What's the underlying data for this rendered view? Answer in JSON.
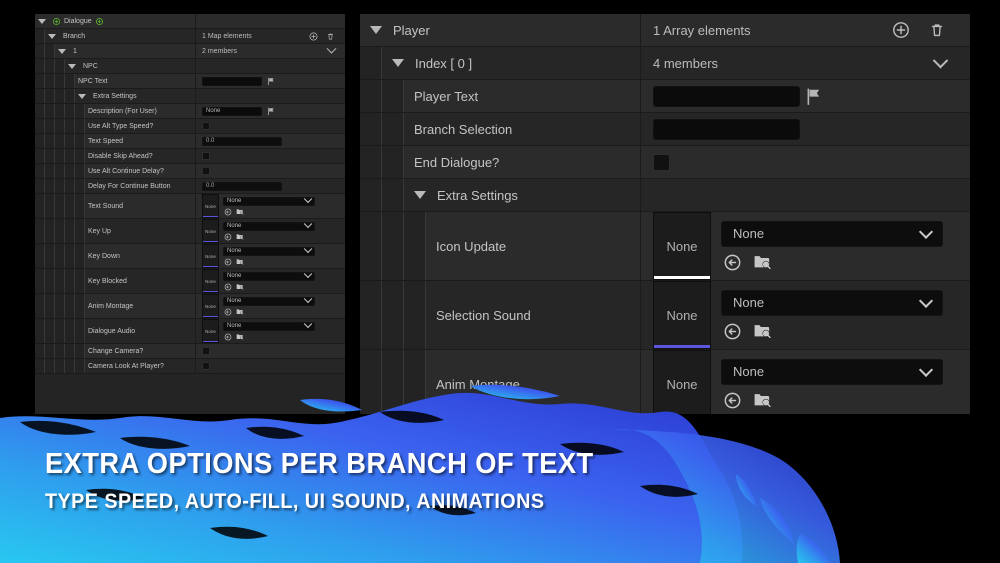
{
  "left_panel": {
    "rows": [
      {
        "kind": "header",
        "depth": 0,
        "label": "Dialogue",
        "tri": true,
        "green_icons": 2,
        "value_kind": "none"
      },
      {
        "kind": "header",
        "depth": 1,
        "label": "Branch",
        "tri": true,
        "value_kind": "count_actions",
        "value_text": "1 Map elements",
        "actions": [
          "add-icon",
          "trash-icon"
        ]
      },
      {
        "kind": "key",
        "depth": 2,
        "label": "1",
        "tri": true,
        "value_kind": "count_chevron",
        "value_text": "2 members"
      },
      {
        "kind": "header",
        "depth": 3,
        "label": "NPC",
        "tri": true,
        "value_kind": "none"
      },
      {
        "kind": "prop",
        "depth": 4,
        "label": "NPC Text",
        "value_kind": "text_flag",
        "value_text": ""
      },
      {
        "kind": "header",
        "depth": 4,
        "label": "Extra Settings",
        "tri": true,
        "value_kind": "none"
      },
      {
        "kind": "prop",
        "depth": 5,
        "label": "Description (For User)",
        "value_kind": "text_flag",
        "value_text": "None"
      },
      {
        "kind": "prop",
        "depth": 5,
        "label": "Use Alt Type Speed?",
        "value_kind": "checkbox"
      },
      {
        "kind": "prop",
        "depth": 5,
        "label": "Text Speed",
        "value_kind": "number",
        "value_text": "0.0"
      },
      {
        "kind": "prop",
        "depth": 5,
        "label": "Disable Skip Ahead?",
        "value_kind": "checkbox"
      },
      {
        "kind": "prop",
        "depth": 5,
        "label": "Use Alt Continue Delay?",
        "value_kind": "checkbox"
      },
      {
        "kind": "prop",
        "depth": 5,
        "label": "Delay For Continue Button",
        "value_kind": "number",
        "value_text": "0.0"
      },
      {
        "kind": "prop",
        "depth": 5,
        "label": "Text Sound",
        "value_kind": "asset",
        "thumb_text": "None",
        "combo_text": "None",
        "bar_color": "#5b55e0"
      },
      {
        "kind": "prop",
        "depth": 5,
        "label": "Key Up",
        "value_kind": "asset",
        "thumb_text": "None",
        "combo_text": "None",
        "bar_color": "#5b55e0"
      },
      {
        "kind": "prop",
        "depth": 5,
        "label": "Key Down",
        "value_kind": "asset",
        "thumb_text": "None",
        "combo_text": "None",
        "bar_color": "#5b55e0"
      },
      {
        "kind": "prop",
        "depth": 5,
        "label": "Key Blocked",
        "value_kind": "asset",
        "thumb_text": "None",
        "combo_text": "None",
        "bar_color": "#5b55e0"
      },
      {
        "kind": "prop",
        "depth": 5,
        "label": "Anim Montage",
        "value_kind": "asset",
        "thumb_text": "None",
        "combo_text": "None",
        "bar_color": "#5b55e0"
      },
      {
        "kind": "prop",
        "depth": 5,
        "label": "Dialogue Audio",
        "value_kind": "asset",
        "thumb_text": "None",
        "combo_text": "None",
        "bar_color": "#5b55e0"
      },
      {
        "kind": "prop",
        "depth": 5,
        "label": "Change Camera?",
        "value_kind": "checkbox"
      },
      {
        "kind": "prop",
        "depth": 5,
        "label": "Camera Look At Player?",
        "value_kind": "checkbox"
      }
    ]
  },
  "right_panel": {
    "rows": [
      {
        "kind": "header",
        "depth": 0,
        "label": "Player",
        "tri": true,
        "value_kind": "count_actions",
        "value_text": "1 Array elements",
        "actions": [
          "add-icon",
          "trash-icon"
        ]
      },
      {
        "kind": "header",
        "depth": 1,
        "label": "Index [ 0 ]",
        "tri": true,
        "value_kind": "count_chevron",
        "value_text": "4 members"
      },
      {
        "kind": "prop",
        "depth": 2,
        "label": "Player Text",
        "value_kind": "text_flag",
        "value_text": ""
      },
      {
        "kind": "prop",
        "depth": 2,
        "label": "Branch Selection",
        "value_kind": "text",
        "value_text": ""
      },
      {
        "kind": "prop",
        "depth": 2,
        "label": "End Dialogue?",
        "value_kind": "checkbox"
      },
      {
        "kind": "header",
        "depth": 2,
        "label": "Extra Settings",
        "tri": true,
        "value_kind": "none"
      },
      {
        "kind": "prop",
        "depth": 3,
        "label": "Icon Update",
        "value_kind": "asset",
        "thumb_text": "None",
        "combo_text": "None",
        "bar_color": "#ffffff"
      },
      {
        "kind": "prop",
        "depth": 3,
        "label": "Selection Sound",
        "value_kind": "asset",
        "thumb_text": "None",
        "combo_text": "None",
        "bar_color": "#5b55e0"
      },
      {
        "kind": "prop",
        "depth": 3,
        "label": "Anim Montage",
        "value_kind": "asset",
        "thumb_text": "None",
        "combo_text": "None",
        "bar_color": "#5b55e0"
      }
    ]
  },
  "banner": {
    "title": "EXTRA OPTIONS PER BRANCH OF TEXT",
    "subtitle": "TYPE SPEED, AUTO-FILL, UI SOUND, ANIMATIONS",
    "gradient_from": "#2fb8e8",
    "gradient_mid": "#3a6bf0",
    "gradient_to": "#2b3fd6"
  }
}
